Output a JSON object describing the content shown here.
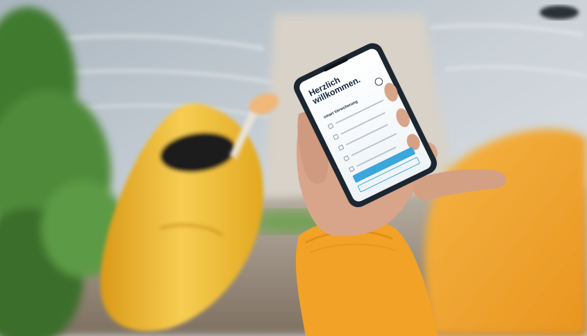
{
  "colors": {
    "water": "#c9d0d6",
    "foliage": "#4f8a3a",
    "kayak": "#f2c13a",
    "sweater": "#f1a22b",
    "skin": "#d9a58a",
    "phone_frame": "#1c2630",
    "screen_accent": "#3aa6dc"
  },
  "phone_screen": {
    "title": "Herzlich willkommen.",
    "section_heading": "smart Versicherung"
  },
  "icons": {
    "screen_logo": "fingerprint-icon"
  }
}
